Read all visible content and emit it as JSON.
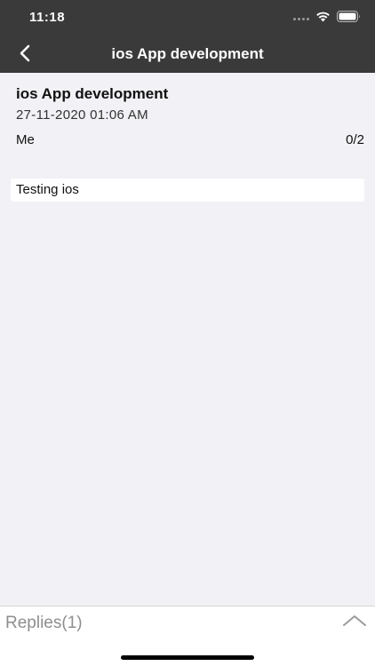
{
  "status_bar": {
    "time": "11:18"
  },
  "nav": {
    "title": "ios App development",
    "back_icon": "chevron-left-icon"
  },
  "post": {
    "title": "ios App development",
    "date": "27-11-2020 01:06 AM",
    "author": "Me",
    "count": "0/2",
    "message": "Testing ios"
  },
  "replies": {
    "label": "Replies(1)",
    "expand_icon": "chevron-up-icon"
  },
  "colors": {
    "header_bg": "#3a3a3a",
    "page_bg": "#f1f1f6",
    "card_bg": "#ffffff",
    "muted_text": "#8e8e8e"
  }
}
